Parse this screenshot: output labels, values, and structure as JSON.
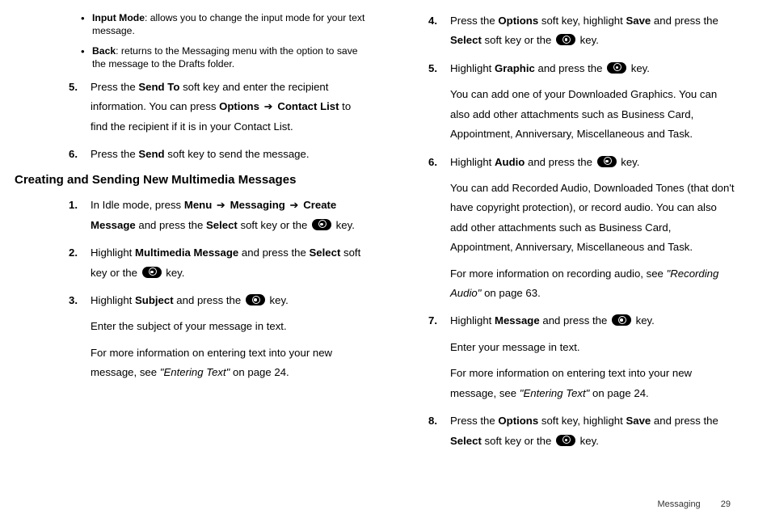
{
  "col1": {
    "bullets": [
      {
        "label": "Input Mode",
        "rest": ": allows you to change the input mode for your text message."
      },
      {
        "label": "Back",
        "rest": ": returns to the Messaging menu with the option to save the message to the Drafts folder."
      }
    ],
    "step5": {
      "num": "5.",
      "t1": "Press the ",
      "b1": "Send To",
      "t2": " soft key and enter the recipient information. You can press ",
      "b2": "Options",
      "arrow": " ➔ ",
      "b3": "Contact List",
      "t3": " to find the recipient if it is in your Contact List."
    },
    "step6": {
      "num": "6.",
      "t1": "Press the ",
      "b1": "Send",
      "t2": " soft key to send the message."
    },
    "heading": "Creating and Sending New Multimedia Messages",
    "m1": {
      "num": "1.",
      "t1": "In Idle mode, press ",
      "b1": "Menu",
      "arrow1": " ➔ ",
      "b2": "Messaging",
      "arrow2": " ➔ ",
      "b3": "Create Message",
      "t2": " and press the ",
      "b4": "Select",
      "t3": " soft key or the ",
      "t4": " key."
    },
    "m2": {
      "num": "2.",
      "t1": "Highlight ",
      "b1": "Multimedia Message",
      "t2": " and press the ",
      "b2": "Select",
      "t3": " soft key or the ",
      "t4": " key."
    },
    "m3": {
      "num": "3.",
      "t1": "Highlight ",
      "b1": "Subject",
      "t2": " and press the ",
      "t3": " key.",
      "p2": "Enter the subject of your message in text.",
      "p3a": "For more information on entering text into your new message, see ",
      "p3i": "\"Entering Text\"",
      "p3b": " on page 24."
    }
  },
  "col2": {
    "m4": {
      "num": "4.",
      "t1": "Press the ",
      "b1": "Options",
      "t2": " soft key, highlight ",
      "b2": "Save",
      "t3": " and press the ",
      "b3": "Select",
      "t4": " soft key or the ",
      "t5": " key."
    },
    "m5": {
      "num": "5.",
      "t1": "Highlight ",
      "b1": "Graphic",
      "t2": " and press the ",
      "t3": " key.",
      "p2": "You can add one of your Downloaded Graphics. You can also add other attachments such as Business Card, Appointment, Anniversary, Miscellaneous and Task."
    },
    "m6": {
      "num": "6.",
      "t1": "Highlight ",
      "b1": "Audio",
      "t2": " and press the ",
      "t3": " key.",
      "p2": "You can add Recorded Audio, Downloaded Tones (that don't have copyright protection), or record audio. You can also add other attachments such as Business Card, Appointment, Anniversary, Miscellaneous and Task.",
      "p3a": "For more information on recording audio, see ",
      "p3i": "\"Recording Audio\"",
      "p3b": " on page 63."
    },
    "m7": {
      "num": "7.",
      "t1": "Highlight ",
      "b1": "Message",
      "t2": " and press the ",
      "t3": " key.",
      "p2": "Enter your message in text.",
      "p3a": "For more information on entering text into your new message, see ",
      "p3i": "\"Entering Text\"",
      "p3b": " on page 24."
    },
    "m8": {
      "num": "8.",
      "t1": "Press the ",
      "b1": "Options",
      "t2": " soft key, highlight ",
      "b2": "Save",
      "t3": " and press the ",
      "b3": "Select",
      "t4": " soft key or the ",
      "t5": " key."
    }
  },
  "footer": {
    "section": "Messaging",
    "page": "29"
  }
}
